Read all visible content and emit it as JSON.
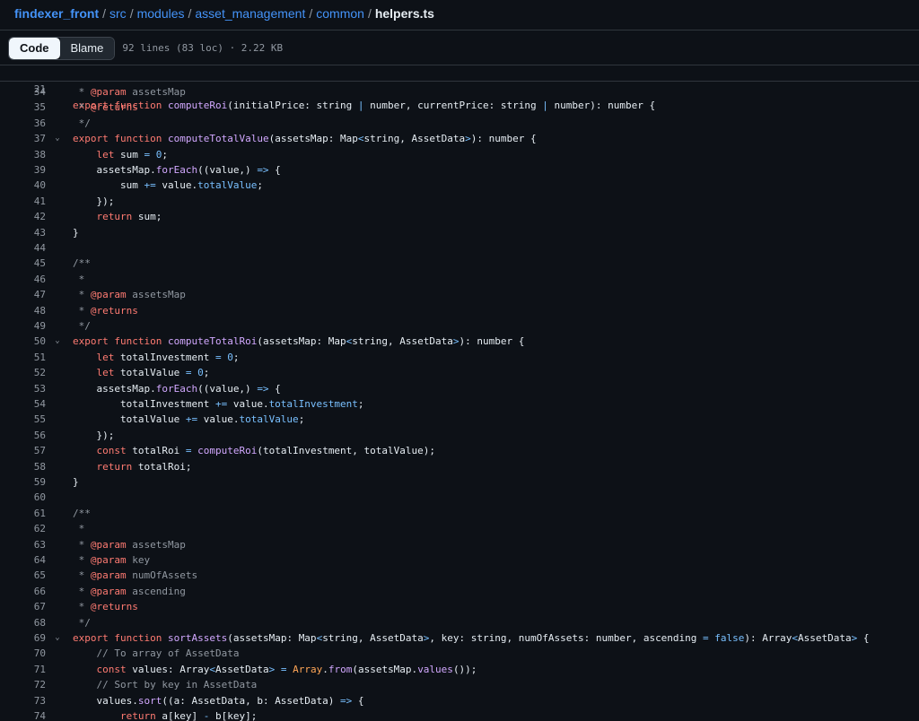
{
  "breadcrumb": {
    "repo": "findexer_front",
    "sep": "/",
    "parts": [
      "src",
      "modules",
      "asset_management",
      "common"
    ],
    "current": "helpers.ts"
  },
  "toolbar": {
    "code_label": "Code",
    "blame_label": "Blame",
    "file_info": "92 lines (83 loc) · 2.22 KB"
  },
  "sticky": {
    "line_number": "21"
  },
  "line_numbers": [
    "34",
    "35",
    "36",
    "37",
    "38",
    "39",
    "40",
    "41",
    "42",
    "43",
    "44",
    "45",
    "46",
    "47",
    "48",
    "49",
    "50",
    "51",
    "52",
    "53",
    "54",
    "55",
    "56",
    "57",
    "58",
    "59",
    "60",
    "61",
    "62",
    "63",
    "64",
    "65",
    "66",
    "67",
    "68",
    "69",
    "70",
    "71",
    "72",
    "73",
    "74"
  ],
  "tokens": {
    "export": "export",
    "function": "function",
    "let": "let",
    "const": "const",
    "return": "return",
    "computeRoi": "computeRoi",
    "computeTotalValue": "computeTotalValue",
    "computeTotalRoi": "computeTotalRoi",
    "sortAssets": "sortAssets",
    "forEach": "forEach",
    "from": "from",
    "values_m": "values",
    "sort": "sort",
    "param": "@param",
    "returns": "@returns",
    "assetsMap": "assetsMap",
    "key": "key",
    "numOfAssets": "numOfAssets",
    "ascending": "ascending",
    "totalValue_p": "totalValue",
    "totalInvestment_p": "totalInvestment",
    "Array": "Array",
    "false": "false",
    "c_to_array": "// To array of AssetData",
    "c_sort_by": "// Sort by key in AssetData"
  }
}
